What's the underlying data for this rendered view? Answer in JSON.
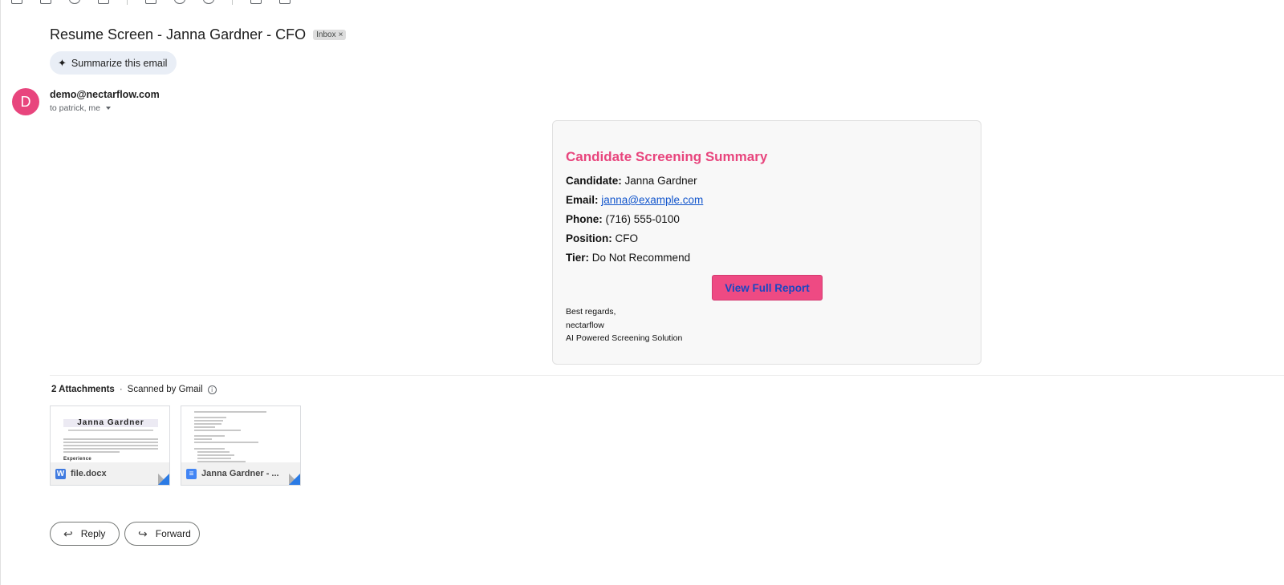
{
  "email": {
    "subject": "Resume Screen - Janna Gardner - CFO",
    "label_chip": "Inbox",
    "label_chip_close": "×",
    "summarize_label": "Summarize this email",
    "sender": "demo@nectarflow.com",
    "avatar_letter": "D",
    "recipients": "to patrick, me"
  },
  "card": {
    "title": "Candidate Screening Summary",
    "fields": [
      {
        "label": "Candidate:",
        "value": "Janna Gardner"
      },
      {
        "label": "Email:",
        "value": "janna@example.com"
      },
      {
        "label": "Phone:",
        "value": "(716) 555-0100"
      },
      {
        "label": "Position:",
        "value": "CFO"
      },
      {
        "label": "Tier:",
        "value": "Do Not Recommend"
      }
    ],
    "button_label": "View Full Report",
    "signoff": [
      "Best regards,",
      "nectarflow",
      "AI Powered Screening Solution"
    ]
  },
  "attachments": {
    "count_label": "2 Attachments",
    "scanned_label": "Scanned by Gmail",
    "items": [
      {
        "name": "file.docx",
        "icon": "word-icon",
        "icon_glyph": "W",
        "preview_title": "Janna Gardner",
        "preview_heading": "Experience"
      },
      {
        "name": "Janna Gardner - ...",
        "icon": "google-docs-icon",
        "icon_glyph": "≡"
      }
    ]
  },
  "actions": {
    "reply_label": "Reply",
    "forward_label": "Forward"
  },
  "colors": {
    "accent_pink": "#e8457d",
    "button_pink": "#ee4a83",
    "link_blue": "#1155cc"
  }
}
